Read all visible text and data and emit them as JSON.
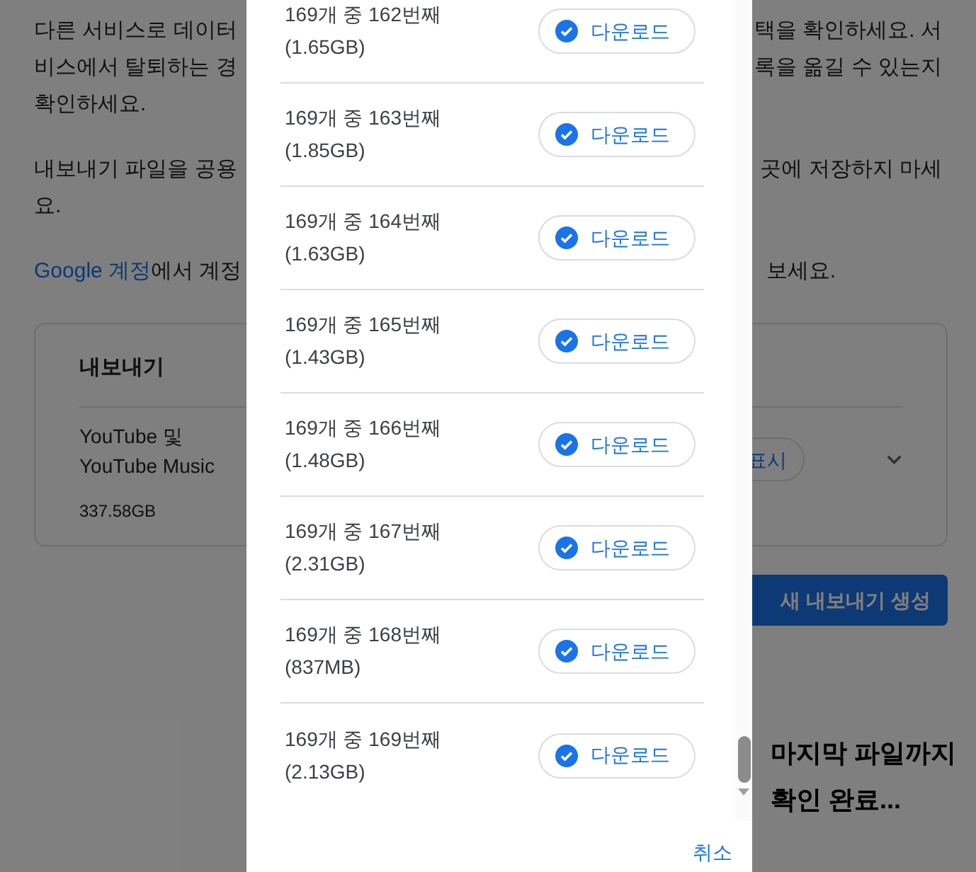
{
  "page": {
    "intro_lines": [
      {
        "left": "다른 서비스로 데이터",
        "right": "택을 확인하세요. 서"
      },
      {
        "left": "비스에서 탈퇴하는 경",
        "right": "록을 옮길 수 있는지"
      },
      {
        "left": "확인하세요."
      }
    ],
    "warning_lines": [
      {
        "left": "내보내기 파일을 공용",
        "right": "곳에 저장하지 마세"
      },
      {
        "left": "요."
      }
    ],
    "account_line": {
      "link": "Google 계정",
      "left": "에서 계정",
      "right": "보세요."
    },
    "export_card": {
      "title": "내보내기",
      "product_lines": [
        "YouTube 및",
        "YouTube Music"
      ],
      "size": "337.58GB",
      "button": "표시"
    },
    "create_button": "새 내보내기 생성"
  },
  "dialog": {
    "files": [
      {
        "label": "169개 중 162번째",
        "size": "(1.65GB)",
        "downloaded": true,
        "button": "다운로드"
      },
      {
        "label": "169개 중 163번째",
        "size": "(1.85GB)",
        "downloaded": true,
        "button": "다운로드"
      },
      {
        "label": "169개 중 164번째",
        "size": "(1.63GB)",
        "downloaded": true,
        "button": "다운로드"
      },
      {
        "label": "169개 중 165번째",
        "size": "(1.43GB)",
        "downloaded": true,
        "button": "다운로드"
      },
      {
        "label": "169개 중 166번째",
        "size": "(1.48GB)",
        "downloaded": true,
        "button": "다운로드"
      },
      {
        "label": "169개 중 167번째",
        "size": "(2.31GB)",
        "downloaded": true,
        "button": "다운로드"
      },
      {
        "label": "169개 중 168번째",
        "size": "(837MB)",
        "downloaded": true,
        "button": "다운로드"
      },
      {
        "label": "169개 중 169번째",
        "size": "(2.13GB)",
        "downloaded": true,
        "button": "다운로드"
      }
    ],
    "cancel": "취소"
  },
  "annotation_lines": [
    "마지막 파일까지",
    "확인 완료..."
  ]
}
